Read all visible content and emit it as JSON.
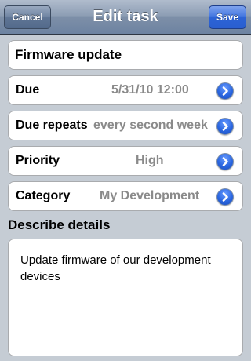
{
  "navbar": {
    "title": "Edit task",
    "cancel_label": "Cancel",
    "save_label": "Save"
  },
  "task": {
    "title": "Firmware update"
  },
  "rows": [
    {
      "label": "Due",
      "value": "5/31/10 12:00"
    },
    {
      "label": "Due repeats",
      "value": "every second week"
    },
    {
      "label": "Priority",
      "value": "High"
    },
    {
      "label": "Category",
      "value": "My Development"
    }
  ],
  "details": {
    "header": "Describe details",
    "text": "Update firmware of our development devices"
  },
  "icons": {
    "disclosure": "chevron-right-circle-icon"
  },
  "colors": {
    "navbar": "#7d8fa8",
    "save_button": "#2c63d6",
    "value_text": "#8a8a8a",
    "background": "#c5ccd4"
  }
}
